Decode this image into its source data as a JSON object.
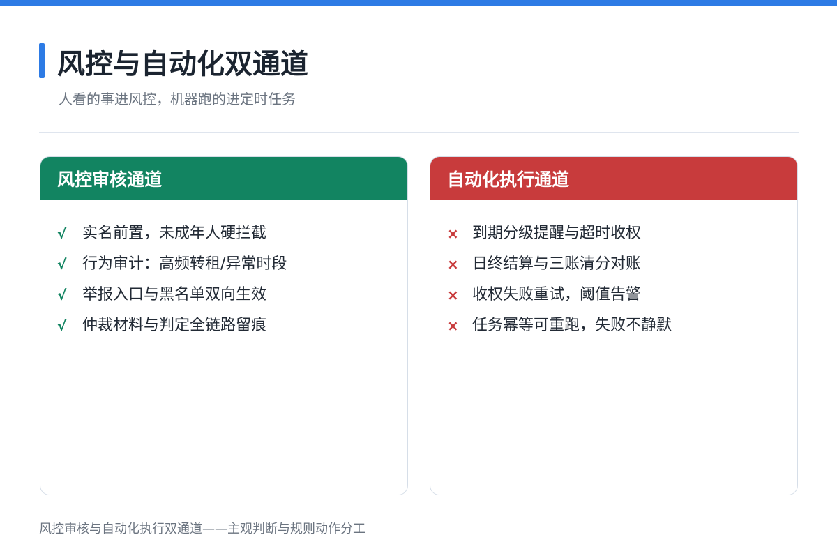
{
  "colors": {
    "top_bar": "#2d7be5",
    "title_accent": "#2d7be5",
    "title_text": "#1b2430",
    "subtitle_text": "#6b7480",
    "divider": "#dfe5ee",
    "left_panel_header": "#128461",
    "right_panel_header": "#c83b3c",
    "check_mark": "#128461",
    "cross_mark": "#c83b3c",
    "footer_text": "#6b7480"
  },
  "header": {
    "title": "风控与自动化双通道",
    "subtitle": "人看的事进风控，机器跑的进定时任务"
  },
  "left_panel": {
    "title": "风控审核通道",
    "mark": "√",
    "mark_icon": "check-icon",
    "items": [
      "实名前置，未成年人硬拦截",
      "行为审计：高频转租/异常时段",
      "举报入口与黑名单双向生效",
      "仲裁材料与判定全链路留痕"
    ]
  },
  "right_panel": {
    "title": "自动化执行通道",
    "mark": "×",
    "mark_icon": "cross-icon",
    "items": [
      "到期分级提醒与超时收权",
      "日终结算与三账清分对账",
      "收权失败重试，阈值告警",
      "任务幂等可重跑，失败不静默"
    ]
  },
  "footer": {
    "caption": "风控审核与自动化执行双通道——主观判断与规则动作分工"
  }
}
